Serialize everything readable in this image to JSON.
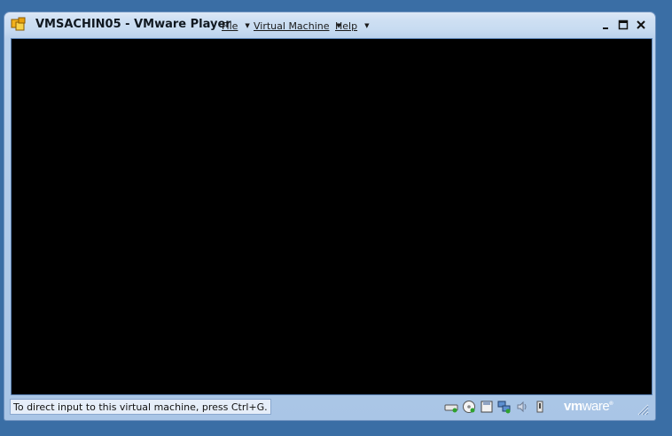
{
  "window": {
    "title": "VMSACHIN05 - VMware Player",
    "app_icon": "vmware-player-icon"
  },
  "menu": [
    {
      "label": "File",
      "caret": "▼"
    },
    {
      "label": "Virtual Machine",
      "caret": "▼"
    },
    {
      "label": "Help",
      "caret": "▼"
    }
  ],
  "controls": {
    "minimize": "minimize-icon",
    "maximize": "maximize-icon",
    "close": "close-icon"
  },
  "status": {
    "hint": "To direct input to this virtual machine, press Ctrl+G.",
    "devices": [
      "hard-disk-icon",
      "cd-rom-icon",
      "floppy-icon",
      "network-icon",
      "sound-icon",
      "usb-icon"
    ]
  },
  "logo": {
    "vm": "vm",
    "ware": "ware",
    "mark": "®"
  },
  "colors": {
    "desktop": "#3a6ea5",
    "frame": "#b9d1ec",
    "screen": "#000000"
  }
}
